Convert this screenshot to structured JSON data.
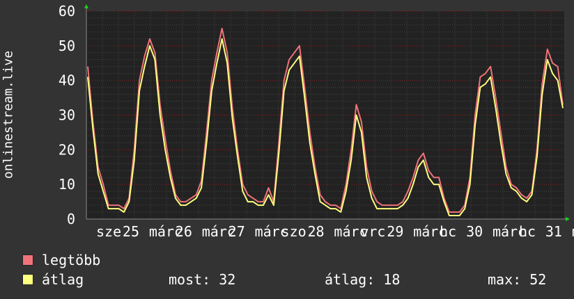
{
  "chart_data": {
    "type": "line",
    "ylabel": "onlinestream.live",
    "ylim": [
      0,
      60
    ],
    "yticks": [
      0,
      10,
      20,
      30,
      40,
      50,
      60
    ],
    "xtick_labels": [
      "sze",
      "25",
      "márc",
      "26",
      "márc",
      "27",
      "márc",
      "szo",
      "28",
      "márc",
      "vrc",
      "29",
      "márc",
      "hc",
      "30",
      "márc",
      "hc",
      "31",
      "má"
    ],
    "grid": true,
    "legend_placement": "bottom-left",
    "series": [
      {
        "name": "legtöbb",
        "color": "#f0737a",
        "values": [
          44,
          28,
          15,
          10,
          4,
          4,
          4,
          3,
          6,
          20,
          40,
          47,
          52,
          48,
          33,
          23,
          14,
          7,
          5,
          5,
          6,
          7,
          11,
          25,
          40,
          48,
          55,
          48,
          32,
          20,
          10,
          7,
          6,
          5,
          5,
          9,
          5,
          22,
          40,
          46,
          48,
          50,
          38,
          25,
          15,
          7,
          5,
          4,
          4,
          3,
          10,
          20,
          33,
          28,
          15,
          8,
          5,
          4,
          4,
          4,
          4,
          5,
          8,
          12,
          17,
          19,
          14,
          12,
          12,
          6,
          2,
          2,
          2,
          4,
          12,
          30,
          41,
          42,
          44,
          35,
          25,
          15,
          10,
          9,
          7,
          6,
          8,
          20,
          39,
          49,
          45,
          44,
          33
        ]
      },
      {
        "name": "átlag",
        "color": "#ffff80",
        "values": [
          41,
          26,
          13,
          8,
          3,
          3,
          3,
          2,
          5,
          17,
          37,
          44,
          50,
          46,
          30,
          20,
          12,
          6,
          4,
          4,
          5,
          6,
          9,
          22,
          37,
          45,
          52,
          45,
          29,
          18,
          8,
          5,
          5,
          4,
          4,
          7,
          4,
          19,
          37,
          43,
          45,
          47,
          35,
          22,
          13,
          5,
          4,
          3,
          3,
          2,
          8,
          17,
          30,
          25,
          12,
          6,
          3,
          3,
          3,
          3,
          3,
          4,
          6,
          10,
          15,
          17,
          12,
          10,
          10,
          5,
          1,
          1,
          1,
          3,
          10,
          27,
          38,
          39,
          41,
          32,
          22,
          13,
          9,
          8,
          6,
          5,
          7,
          18,
          36,
          46,
          42,
          40,
          32
        ]
      }
    ]
  },
  "legend": {
    "items": [
      {
        "label": "legtöbb",
        "color": "#f0737a"
      },
      {
        "label": "átlag",
        "color": "#ffff80"
      }
    ]
  },
  "stats": {
    "current": "most: 32",
    "average": "átlag: 18",
    "max": "max: 52"
  },
  "colors": {
    "background": "#333333",
    "plot_background": "#222222",
    "grid_minor": "#444444",
    "grid_major": "#8a1f1f",
    "axis_arrow": "#22cc22"
  }
}
